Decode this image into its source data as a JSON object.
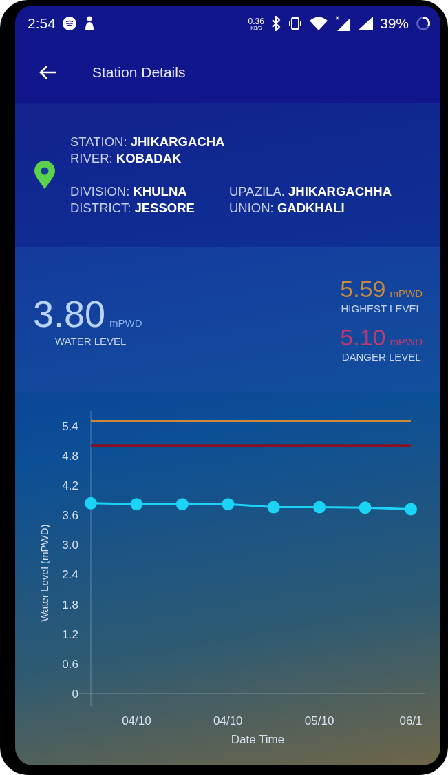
{
  "status_bar": {
    "time": "2:54",
    "net_speed": "0.36",
    "net_speed_unit": "KB/S",
    "battery": "39%"
  },
  "app_bar": {
    "title": "Station Details"
  },
  "station": {
    "fields": [
      {
        "label": "STATION:",
        "value": "JHIKARGACHA"
      },
      {
        "label": "RIVER:",
        "value": "KOBADAK"
      }
    ],
    "location": [
      {
        "label": "DIVISION:",
        "value": "KHULNA"
      },
      {
        "label": "UPAZILA.",
        "value": "JHIKARGACHHA"
      },
      {
        "label": "DISTRICT:",
        "value": "JESSORE"
      },
      {
        "label": "UNION:",
        "value": "GADKHALI"
      }
    ]
  },
  "levels": {
    "current": {
      "value": "3.80",
      "unit": "mPWD",
      "caption": "WATER LEVEL"
    },
    "others": [
      {
        "value": "5.59",
        "unit": "mPWD",
        "caption": "HIGHEST LEVEL",
        "color": "#c8893a"
      },
      {
        "value": "5.10",
        "unit": "mPWD",
        "caption": "DANGER LEVEL",
        "color": "#c03a6e"
      }
    ]
  },
  "chart_data": {
    "type": "line",
    "xlabel": "Date Time",
    "ylabel": "Water Level (mPWD)",
    "categories": [
      null,
      "04/10",
      null,
      "04/10",
      null,
      "05/10",
      null,
      "06/1"
    ],
    "ylim": [
      0,
      5.7
    ],
    "yticks": [
      {
        "value": 0,
        "label": "0"
      },
      {
        "value": 0.6,
        "label": "0.6"
      },
      {
        "value": 1.2,
        "label": "1.2"
      },
      {
        "value": 1.8,
        "label": "1.8"
      },
      {
        "value": 2.4,
        "label": "2.4"
      },
      {
        "value": 3.0,
        "label": "3.0"
      },
      {
        "value": 3.6,
        "label": "3.6"
      },
      {
        "value": 4.2,
        "label": "4.2"
      },
      {
        "value": 4.8,
        "label": "4.8"
      },
      {
        "value": 5.4,
        "label": "5.4"
      }
    ],
    "series": [
      {
        "color": "#c8893a",
        "values": [
          5.5,
          5.5,
          5.5,
          5.5,
          5.5,
          5.5,
          5.5,
          5.5
        ]
      },
      {
        "color": "#8b1020",
        "values": [
          5.0,
          5.0,
          5.0,
          5.0,
          5.0,
          5.0,
          5.0,
          5.0
        ]
      },
      {
        "color": "#1ad3f5",
        "marker": "circle",
        "values": [
          3.84,
          3.82,
          3.82,
          3.82,
          3.76,
          3.76,
          3.75,
          3.72
        ]
      }
    ]
  }
}
